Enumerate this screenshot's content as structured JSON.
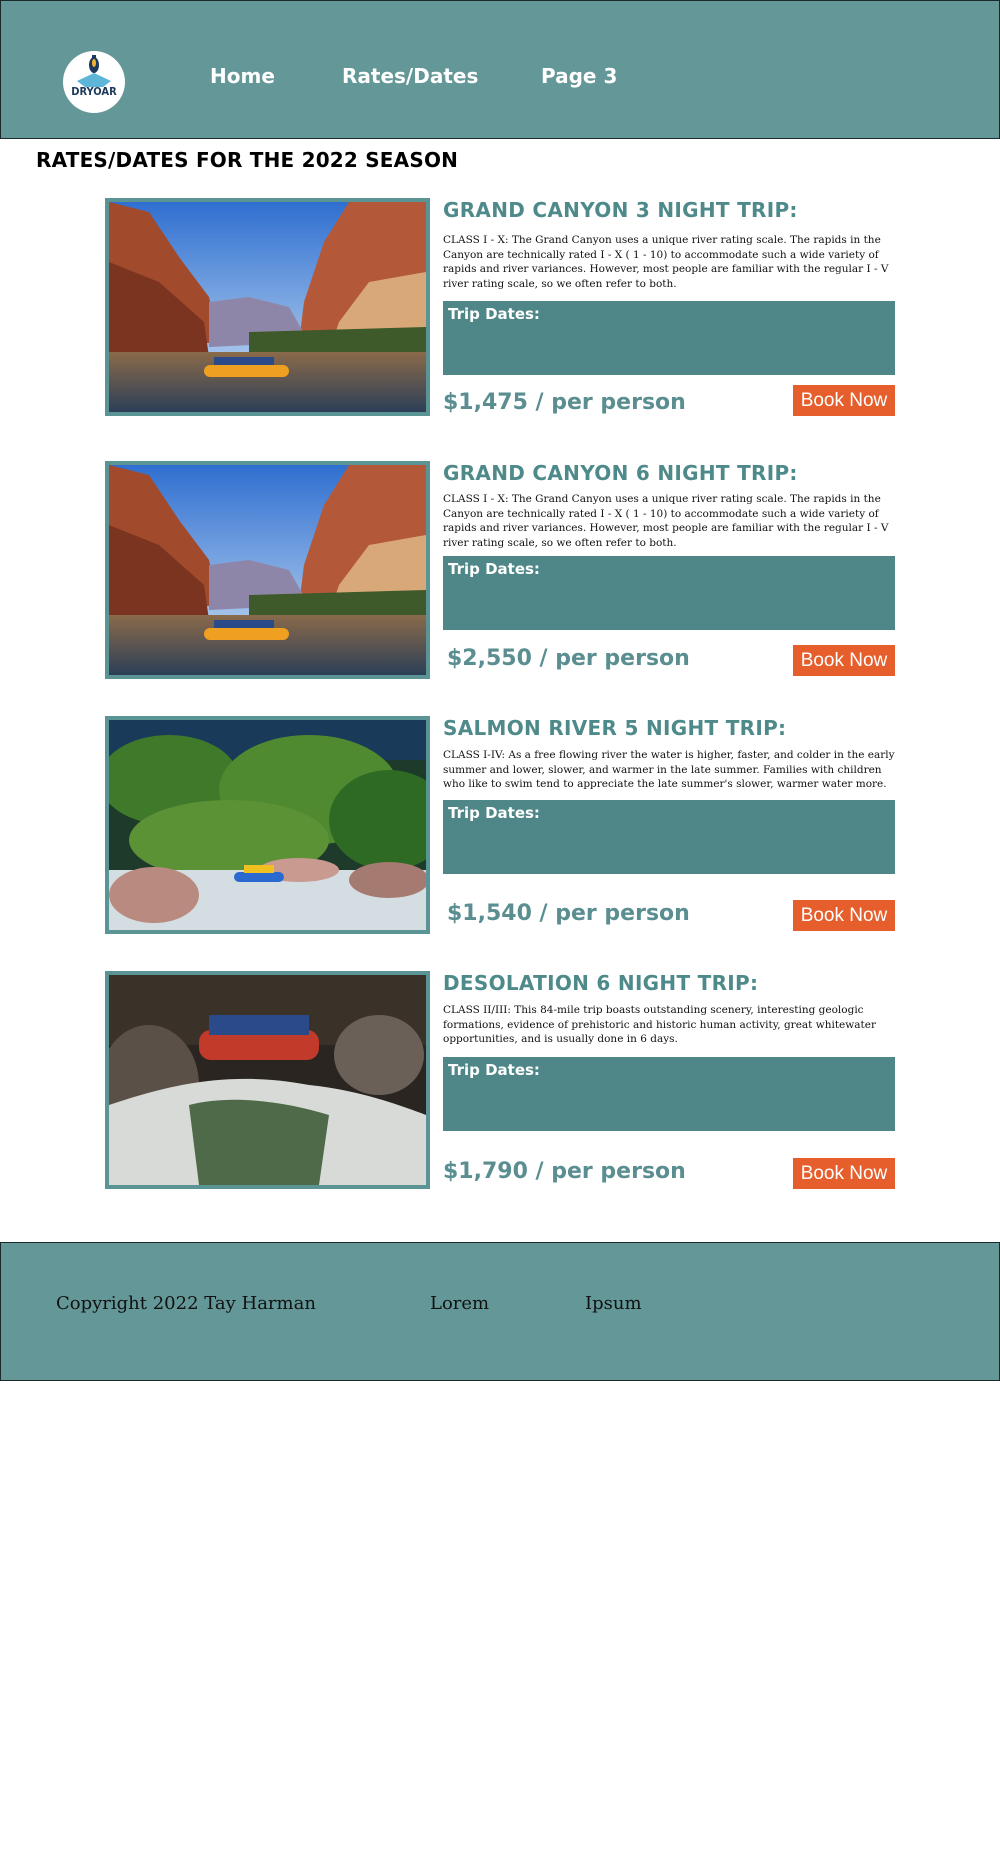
{
  "header": {
    "logo_text": "DRYOAR",
    "nav": [
      {
        "label": "Home"
      },
      {
        "label": "Rates/Dates"
      },
      {
        "label": "Page 3"
      }
    ]
  },
  "page": {
    "title": "RATES/DATES FOR THE 2022 SEASON"
  },
  "trips": [
    {
      "title": "GRAND CANYON 3 NIGHT TRIP:",
      "description": "CLASS I - X: The Grand Canyon uses a unique river rating scale. The rapids in the Canyon are technically rated I - X ( 1 - 10) to accommodate such a wide variety of rapids and river variances. However, most people are familiar with the regular I - V river rating scale, so we often refer to both.",
      "dates_label": "Trip Dates:",
      "price": "$1,475 / per person",
      "book_label": "Book Now",
      "photo": "canyon-raft-photo"
    },
    {
      "title": "GRAND CANYON 6 NIGHT TRIP:",
      "description": "CLASS I - X: The Grand Canyon uses a unique river rating scale. The rapids in the Canyon are technically rated I - X ( 1 - 10) to accommodate such a wide variety of rapids and river variances. However, most people are familiar with the regular I - V river rating scale, so we often refer to both.",
      "dates_label": "Trip Dates:",
      "price": "$2,550 / per person",
      "book_label": "Book Now",
      "photo": "canyon-raft-photo"
    },
    {
      "title": "SALMON RIVER 5 NIGHT TRIP:",
      "description": "CLASS I-IV: As a free flowing river the water is higher, faster, and colder in the early summer and lower, slower, and warmer in the late summer. Families with children who like to swim tend to appreciate the late summer's slower, warmer water more.",
      "dates_label": "Trip Dates:",
      "price": "$1,540 / per person",
      "book_label": "Book Now",
      "photo": "jungle-rapids-photo"
    },
    {
      "title": "DESOLATION 6 NIGHT TRIP:",
      "description": "CLASS II/III: This 84-mile trip boasts outstanding scenery, interesting geologic formations, evidence of prehistoric and historic human activity, great whitewater opportunities, and is usually done in 6 days.",
      "dates_label": "Trip Dates:",
      "price": "$1,790 / per person",
      "book_label": "Book Now",
      "photo": "waterfall-raft-photo"
    }
  ],
  "footer": {
    "copyright": "Copyright 2022 Tay Harman",
    "link1": "Lorem",
    "link2": "Ipsum"
  },
  "colors": {
    "header_bg": "#649797",
    "title_teal": "#4f8a8b",
    "dates_bg": "#4f8788",
    "book_button": "#e55e2b"
  }
}
